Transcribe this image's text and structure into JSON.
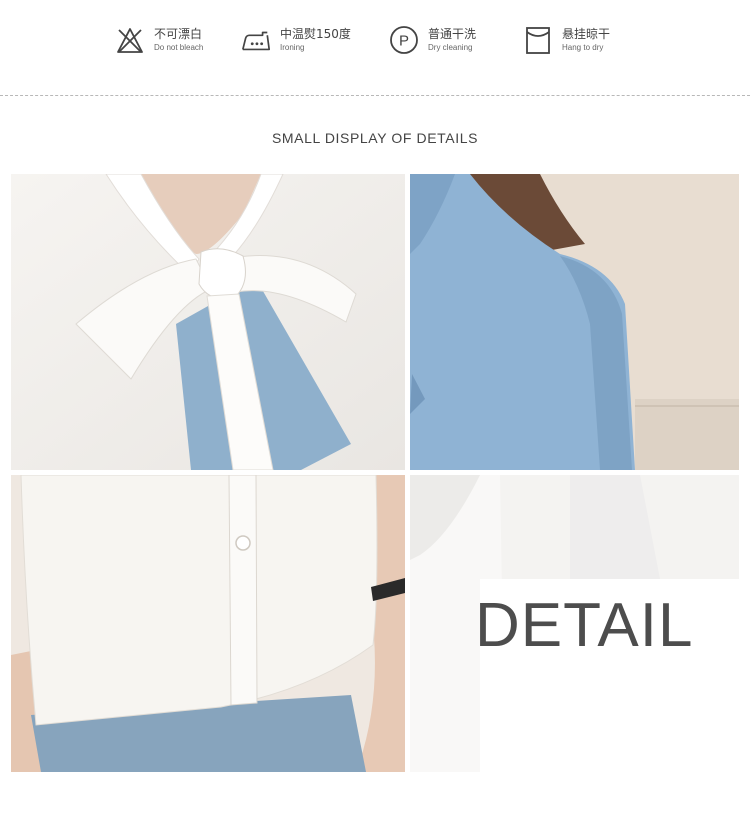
{
  "care_instructions": [
    {
      "icon": "no-bleach-icon",
      "zh": "不可漂白",
      "en": "Do not bleach"
    },
    {
      "icon": "iron-icon",
      "zh": "中温熨150度",
      "en": "Ironing"
    },
    {
      "icon": "dry-clean-icon",
      "zh": "普通干洗",
      "en": "Dry cleaning"
    },
    {
      "icon": "hang-dry-icon",
      "zh": "悬挂晾干",
      "en": "Hang to dry"
    }
  ],
  "section_title": "SMALL DISPLAY OF DETAILS",
  "detail_word": "DETAIL",
  "colors": {
    "accent_blue": "#8fb3d4",
    "blouse_white": "#f3f0ec",
    "text_dark": "#4d4d4d"
  }
}
